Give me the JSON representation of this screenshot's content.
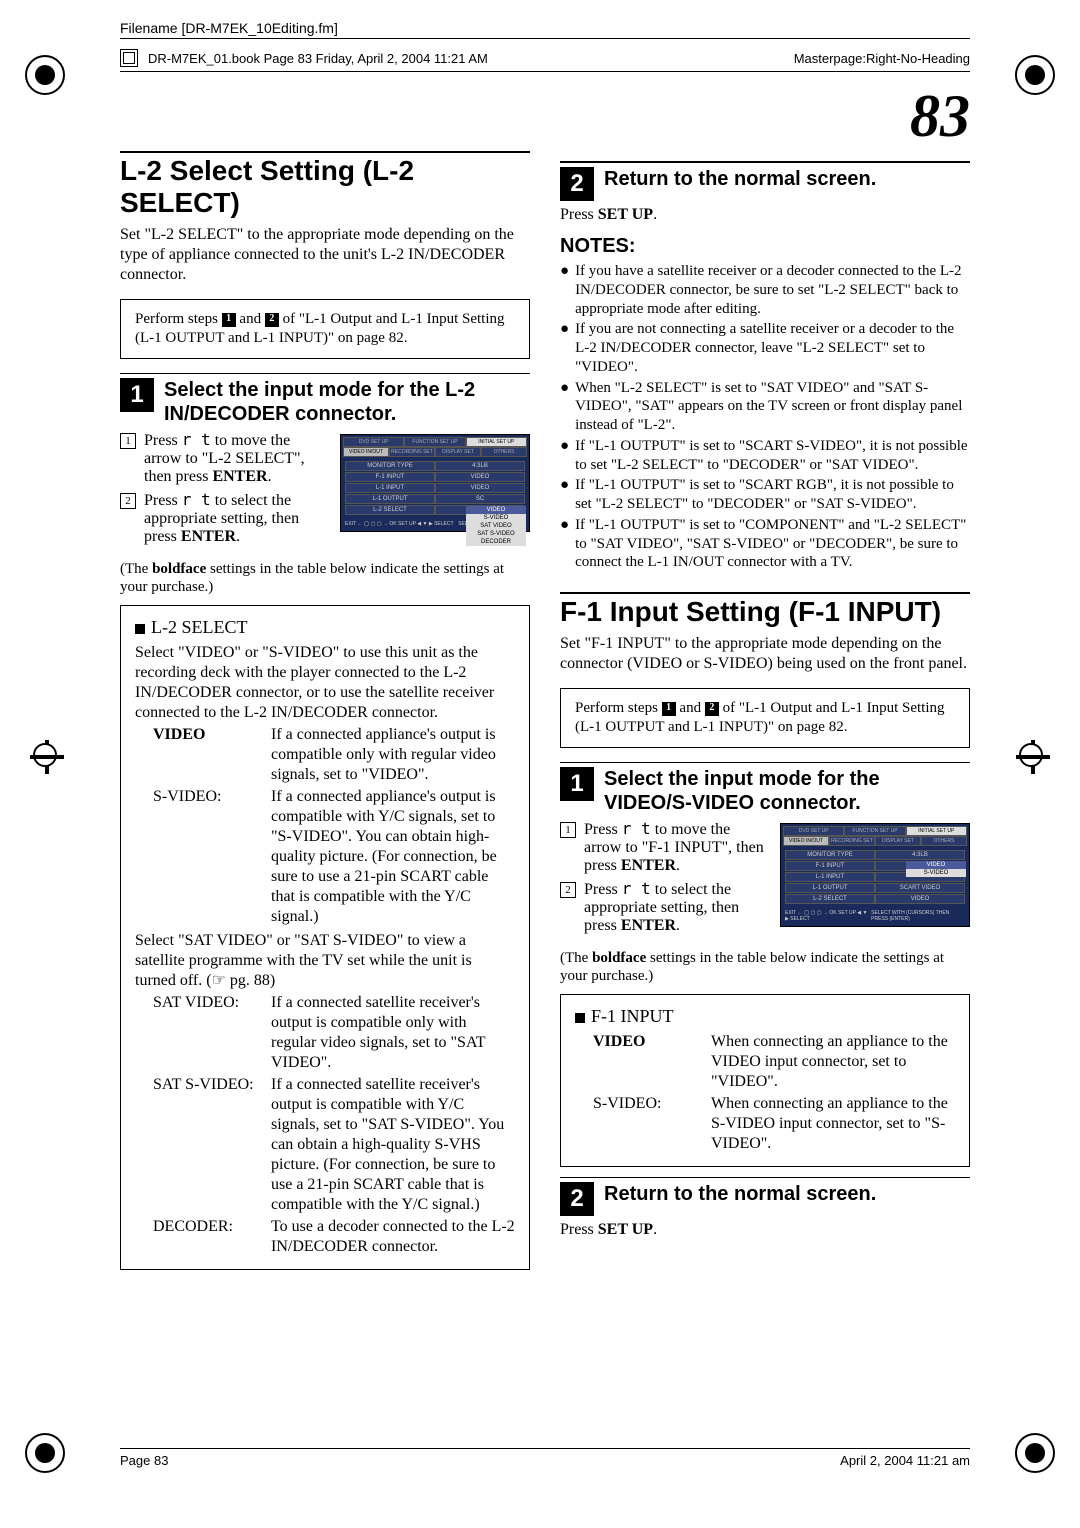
{
  "header": {
    "filename": "Filename [DR-M7EK_10Editing.fm]",
    "masterpage": "Masterpage:Right-No-Heading",
    "bookline": "DR-M7EK_01.book  Page 83  Friday, April 2, 2004  11:21 AM"
  },
  "page_number": "83",
  "left": {
    "title": "L-2 Select Setting (L-2 SELECT)",
    "intro": "Set \"L-2 SELECT\" to the appropriate mode depending on the type of appliance connected to the unit's L-2 IN/DECODER connector.",
    "prestep_a": "Perform steps ",
    "prestep_b": " and ",
    "prestep_c": " of \"L-1 Output and L-1 Input Setting (L-1 OUTPUT and L-1 INPUT)\" on page 82.",
    "step1_title": "Select the input mode for the L-2 IN/DECODER connector.",
    "sub1": "Press r t  to move the arrow to \"L-2 SELECT\", then press ENTER.",
    "sub2": "Press r t  to select the appropriate setting, then press ENTER.",
    "osd": {
      "tabs": [
        "DVD SET UP",
        "FUNCTION SET UP",
        "INITIAL SET UP"
      ],
      "subtabs": [
        "VIDEO IN/OUT",
        "RECORDING SET",
        "DISPLAY SET",
        "OTHERS"
      ],
      "rows": [
        {
          "l": "MONITOR TYPE",
          "r": "4:3LB"
        },
        {
          "l": "F-1 INPUT",
          "r": "VIDEO"
        },
        {
          "l": "L-1 INPUT",
          "r": "VIDEO"
        },
        {
          "l": "L-1 OUTPUT",
          "r": "SC"
        },
        {
          "l": "L-2 SELECT",
          "r": ""
        }
      ],
      "list": [
        "VIDEO",
        "S-VIDEO",
        "SAT VIDEO",
        "SAT S-VIDEO",
        "DECODER"
      ],
      "footer_l": "EXIT ← ◯ ▢ ▢ → OK\nSET UP ◀ ▼ ▶ SELECT",
      "footer_r": "SELECT WITH\nTHEN PRESS"
    },
    "bold_note": "(The boldface settings in the table below indicate the settings at your purchase.)",
    "table": {
      "title": "L-2 SELECT",
      "intro": "Select \"VIDEO\" or \"S-VIDEO\" to use this unit as the recording deck with the player connected to the L-2 IN/DECODER connector, or to use the satellite receiver connected to the L-2 IN/DECODER connector.",
      "rows": [
        {
          "k": "VIDEO",
          "v": "If a connected appliance's output is compatible only with regular video signals, set to \"VIDEO\"."
        },
        {
          "k": "S-VIDEO:",
          "v": "If a connected appliance's output is compatible with Y/C signals, set to \"S-VIDEO\". You can obtain high-quality picture. (For connection, be sure to use a 21-pin SCART cable that is compatible with the Y/C signal.)"
        }
      ],
      "intro2": "Select \"SAT VIDEO\" or \"SAT S-VIDEO\" to view a satellite programme with the TV set while the unit is turned off. (☞ pg. 88)",
      "rows2": [
        {
          "k": "SAT VIDEO:",
          "v": "If a connected satellite receiver's output is compatible only with regular video signals, set to \"SAT VIDEO\"."
        },
        {
          "k": "SAT S-VIDEO:",
          "v": "If a connected satellite receiver's output is compatible with Y/C signals, set to \"SAT S-VIDEO\". You can obtain a high-quality S-VHS picture. (For connection, be sure to use a 21-pin SCART cable that is compatible with the Y/C signal.)"
        },
        {
          "k": "DECODER:",
          "v": "To use a decoder connected to the L-2 IN/DECODER connector."
        }
      ]
    }
  },
  "right": {
    "step2_title": "Return to the normal screen.",
    "step2_body": "Press SET UP.",
    "notes_h": "NOTES:",
    "notes": [
      "If you have a satellite receiver or a decoder connected to the L-2 IN/DECODER connector, be sure to set \"L-2 SELECT\" back to appropriate mode after editing.",
      "If you are not connecting a satellite receiver or a decoder to the L-2 IN/DECODER connector, leave \"L-2 SELECT\" set to \"VIDEO\".",
      "When \"L-2 SELECT\" is set to \"SAT VIDEO\" and \"SAT S-VIDEO\", \"SAT\" appears on the TV screen or front display panel instead of \"L-2\".",
      "If \"L-1 OUTPUT\" is set to \"SCART S-VIDEO\", it is not possible to set \"L-2 SELECT\" to \"DECODER\" or \"SAT VIDEO\".",
      "If \"L-1 OUTPUT\" is set to \"SCART RGB\", it is not possible to set \"L-2 SELECT\" to \"DECODER\" or \"SAT S-VIDEO\".",
      "If \"L-1 OUTPUT\" is set to \"COMPONENT\" and \"L-2 SELECT\" to \"SAT VIDEO\", \"SAT S-VIDEO\" or \"DECODER\", be sure to connect the L-1 IN/OUT connector with a TV."
    ],
    "title2": "F-1 Input Setting (F-1 INPUT)",
    "intro2": "Set \"F-1 INPUT\" to the appropriate mode depending on the connector (VIDEO or S-VIDEO) being used on the front panel.",
    "prestep2_a": "Perform steps ",
    "prestep2_b": " and ",
    "prestep2_c": " of \"L-1 Output and L-1 Input Setting (L-1 OUTPUT and L-1 INPUT)\" on page 82.",
    "step1b_title": "Select the input mode for the VIDEO/S-VIDEO connector.",
    "sub1b": "Press r t  to move the arrow to \"F-1 INPUT\", then press ENTER.",
    "sub2b": "Press r t  to select the appropriate setting, then press ENTER.",
    "osd2": {
      "tabs": [
        "DVD SET UP",
        "FUNCTION SET UP",
        "INITIAL SET UP"
      ],
      "subtabs": [
        "VIDEO IN/OUT",
        "RECORDING SET",
        "DISPLAY SET",
        "OTHERS"
      ],
      "rows": [
        {
          "l": "MONITOR TYPE",
          "r": "4:3LB"
        },
        {
          "l": "F-1 INPUT",
          "r": ""
        },
        {
          "l": "L-1 INPUT",
          "r": ""
        },
        {
          "l": "L-1 OUTPUT",
          "r": "SCART VIDEO"
        },
        {
          "l": "L-2 SELECT",
          "r": "VIDEO"
        }
      ],
      "list": [
        "VIDEO",
        "S-VIDEO"
      ],
      "footer_l": "EXIT ← ◯ ▢ ▢ → OK\nSET UP ◀ ▼ ▶ SELECT",
      "footer_r": "SELECT WITH (CURSORS)\nTHEN PRESS (ENTER)"
    },
    "bold_note2": "(The boldface settings in the table below indicate the settings at your purchase.)",
    "table2": {
      "title": "F-1 INPUT",
      "rows": [
        {
          "k": "VIDEO",
          "v": "When connecting an appliance to the VIDEO input connector, set to \"VIDEO\"."
        },
        {
          "k": "S-VIDEO:",
          "v": "When connecting an appliance to the S-VIDEO input connector, set to \"S-VIDEO\"."
        }
      ]
    },
    "step2b_title": "Return to the normal screen.",
    "step2b_body": "Press SET UP."
  },
  "footer": {
    "left": "Page 83",
    "right": "April 2, 2004  11:21 am"
  }
}
